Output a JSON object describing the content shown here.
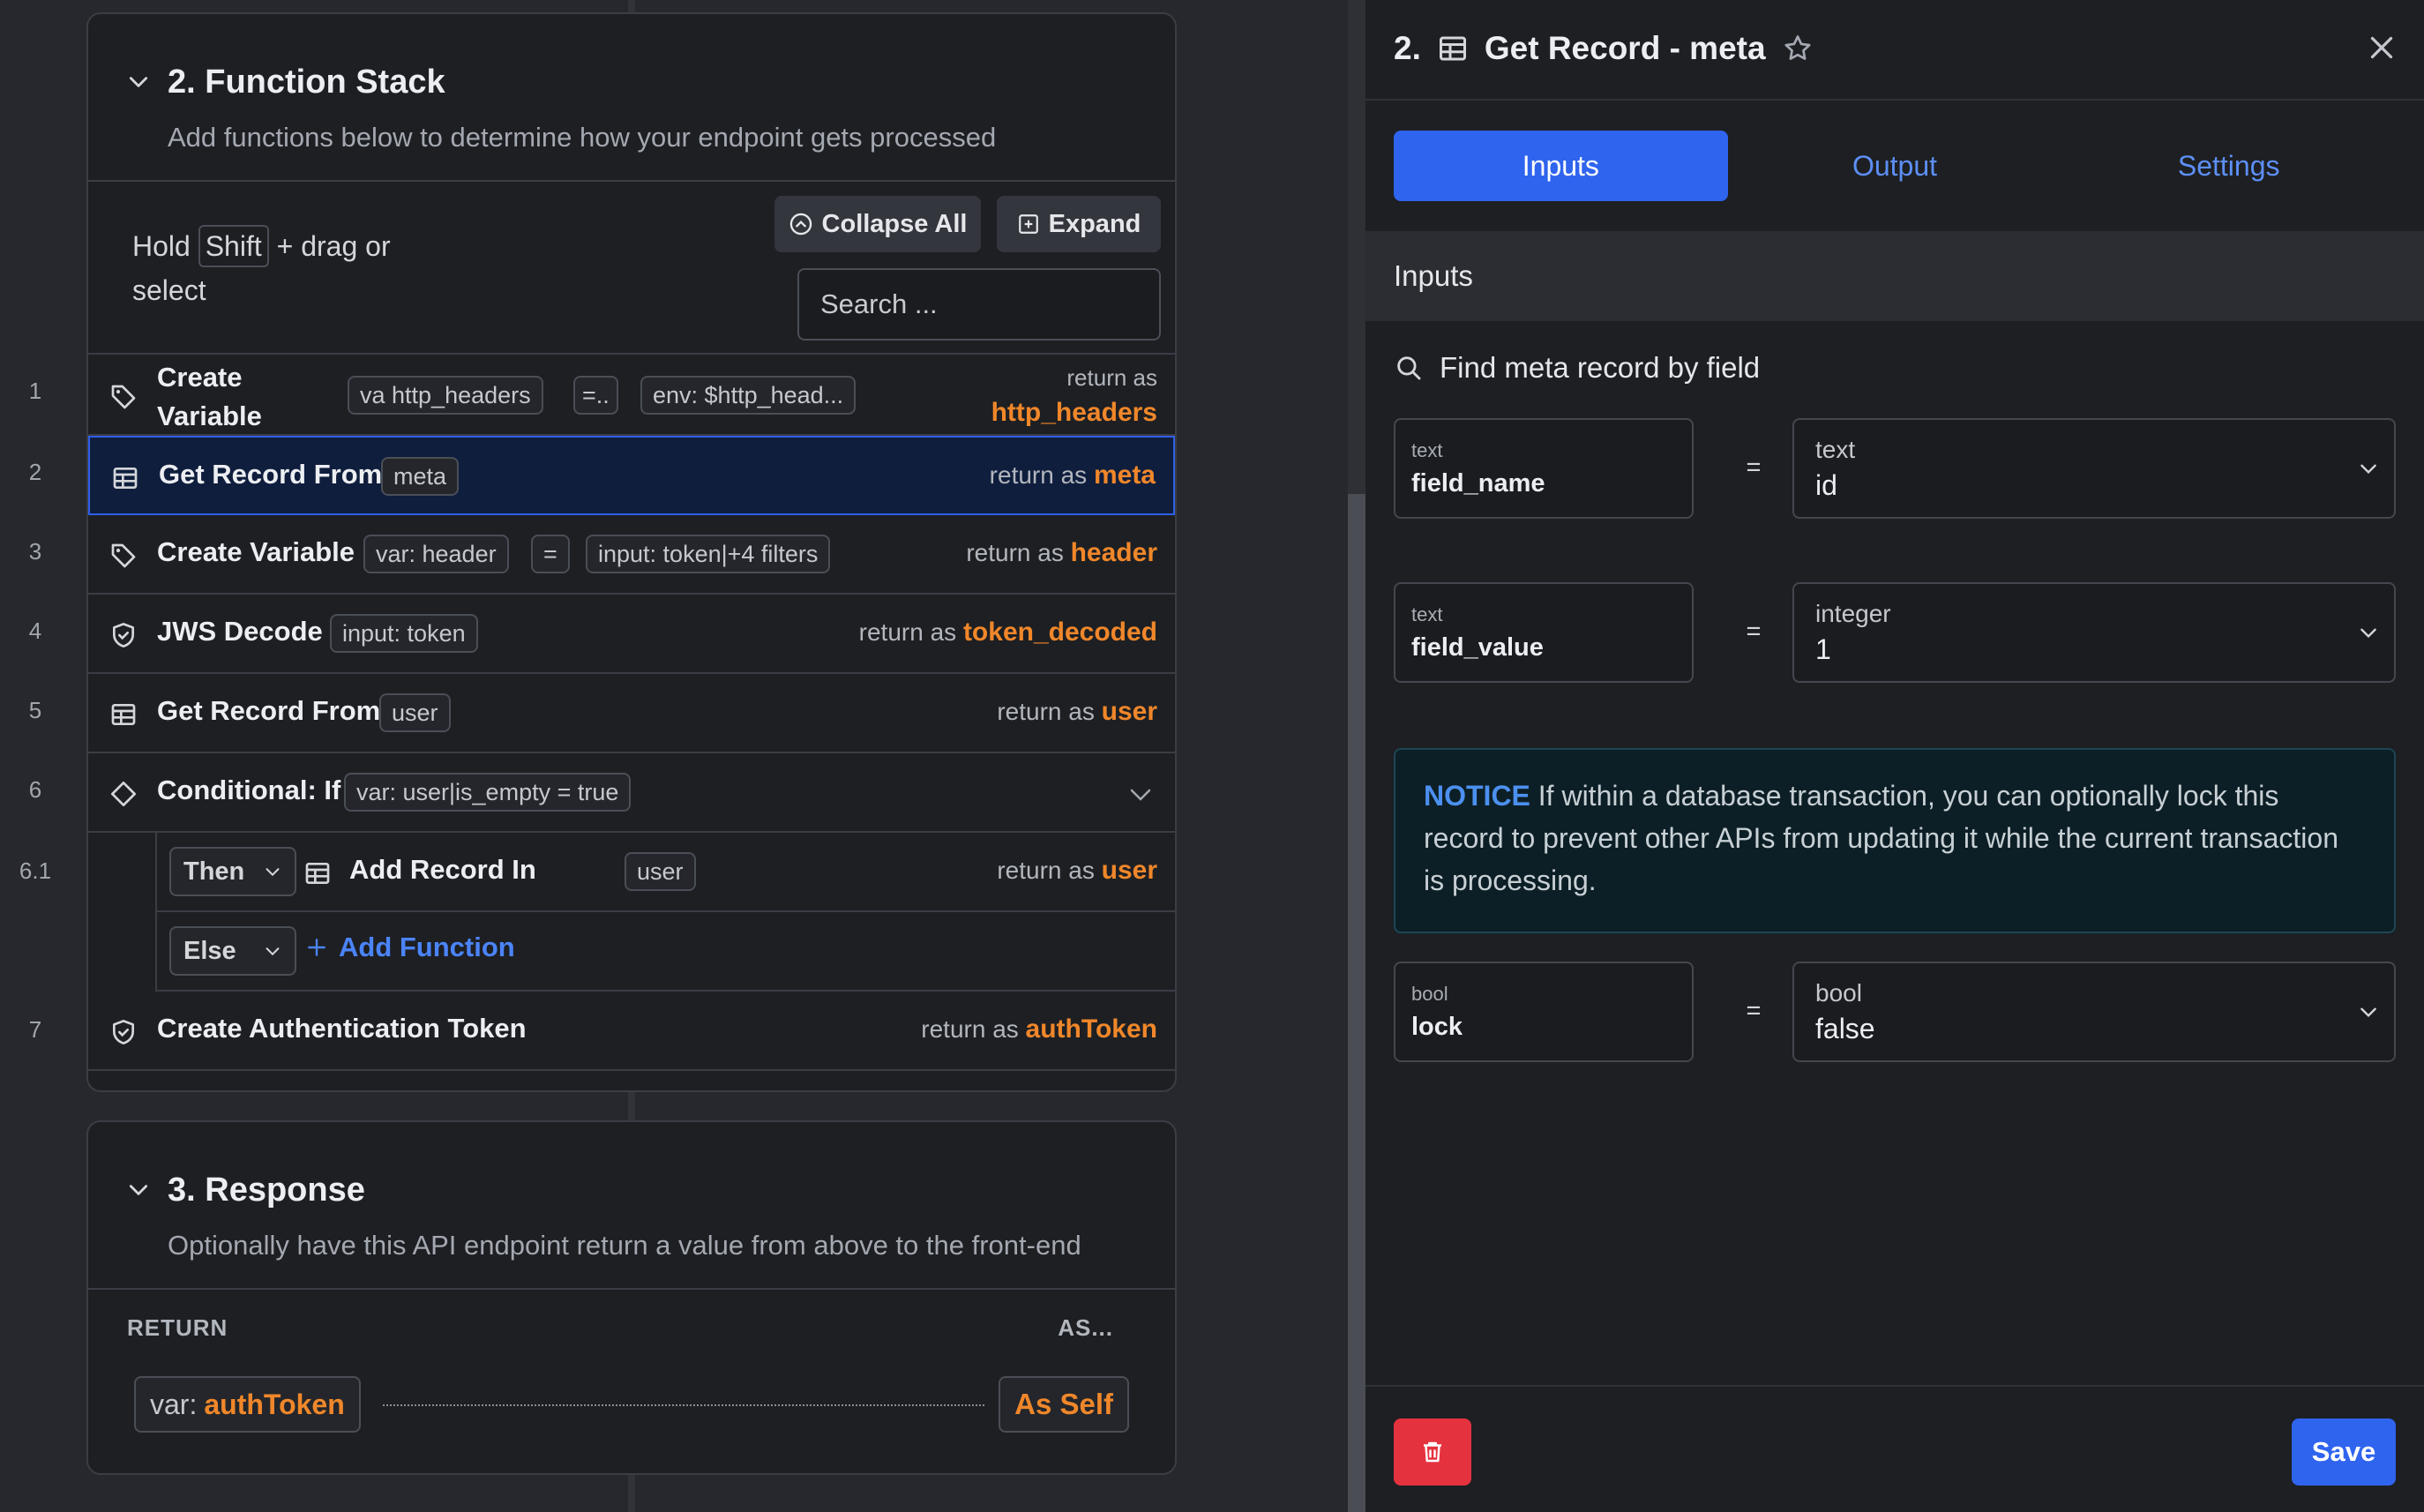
{
  "function_stack": {
    "title": "2. Function Stack",
    "subtitle": "Add functions below to determine how your endpoint gets processed",
    "hold_prefix": "Hold",
    "hold_key": "Shift",
    "hold_suffix": "+ drag or select",
    "collapse_all": "Collapse All",
    "expand": "Expand",
    "search_placeholder": "Search ...",
    "return_as": "return as",
    "rows": [
      {
        "num": "1",
        "icon": "tag-icon",
        "name": "Create Variable",
        "chips": [
          "va  http_headers",
          "=..",
          "env: $http_head..."
        ],
        "return_var": "http_headers"
      },
      {
        "num": "2",
        "icon": "table-icon",
        "name": "Get Record From",
        "chips": [
          "meta"
        ],
        "return_var": "meta"
      },
      {
        "num": "3",
        "icon": "tag-icon",
        "name": "Create Variable",
        "chips": [
          "var:  header",
          "=",
          "input: token|+4 filters"
        ],
        "return_var": "header"
      },
      {
        "num": "4",
        "icon": "shield-icon",
        "name": "JWS Decode",
        "chips": [
          "input: token"
        ],
        "return_var": "token_decoded"
      },
      {
        "num": "5",
        "icon": "table-icon",
        "name": "Get Record From",
        "chips": [
          "user"
        ],
        "return_var": "user"
      },
      {
        "num": "6",
        "icon": "diamond-icon",
        "name": "Conditional: If",
        "chips": [
          "var: user|is_empty  =  true"
        ]
      },
      {
        "num": "6.1",
        "branch": "Then",
        "icon": "table-icon",
        "name": "Add Record In",
        "chips": [
          "user"
        ],
        "return_var": "user"
      },
      {
        "branch": "Else",
        "add_function": "Add Function"
      },
      {
        "num": "7",
        "icon": "shield-icon",
        "name": "Create Authentication Token",
        "return_var": "authToken"
      }
    ]
  },
  "response": {
    "title": "3. Response",
    "subtitle": "Optionally have this API endpoint return a value from above to the front-end",
    "return_label": "RETURN",
    "as_label": "AS...",
    "var_prefix": "var:",
    "var_name": "authToken",
    "as_self": "As Self"
  },
  "panel": {
    "title_num": "2.",
    "title": "Get Record - meta",
    "tabs": [
      "Inputs",
      "Output",
      "Settings"
    ],
    "active_tab": "Inputs",
    "section": "Inputs",
    "find_label": "Find meta record by field",
    "fields": [
      {
        "type": "text",
        "name": "field_name",
        "eq": "=",
        "value_type": "text",
        "value": "id"
      },
      {
        "type": "text",
        "name": "field_value",
        "eq": "=",
        "value_type": "integer",
        "value": "1"
      },
      {
        "type": "bool",
        "name": "lock",
        "eq": "=",
        "value_type": "bool",
        "value": "false"
      }
    ],
    "notice_label": "NOTICE",
    "notice_text": "If within a database transaction, you can optionally lock this record to prevent other APIs from updating it while the current transaction is processing.",
    "save": "Save"
  },
  "colors": {
    "accent_blue": "#2f64ee",
    "return_orange": "#f0872a",
    "delete_red": "#e5323f",
    "selected_row": "#0f1e3d"
  }
}
